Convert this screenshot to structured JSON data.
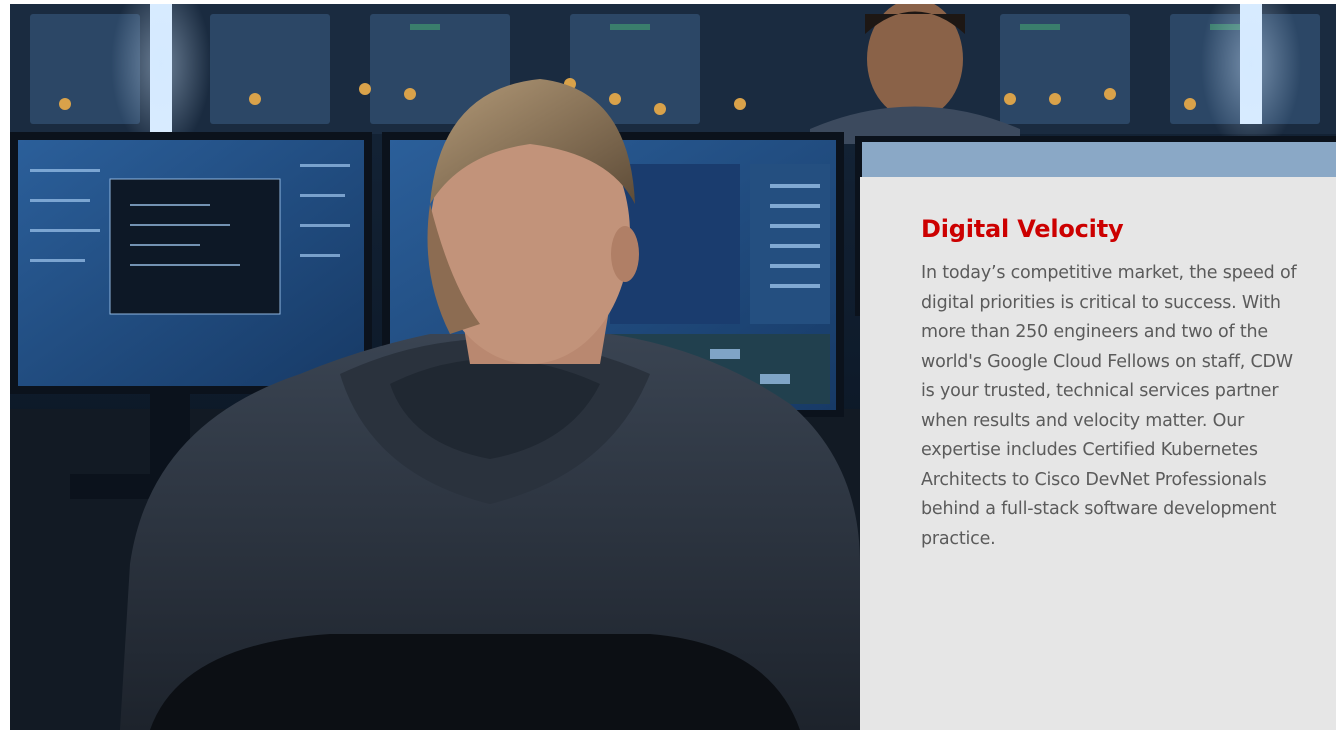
{
  "hero": {
    "image_icon": "photo-developer-at-monitors"
  },
  "card": {
    "title": "Digital Velocity",
    "body": "In today’s competitive market, the speed of digital priorities is critical to success. With more than 250 engineers and two of the world's Google Cloud Fellows on staff, CDW is your trusted, technical services partner when results and velocity matter. Our expertise includes Certified Kubernetes Architects to Cisco DevNet Professionals behind a full-stack software development practice.",
    "title_color": "#cc0000",
    "body_color": "#5b5b5b",
    "background_color": "#e6e6e6"
  }
}
